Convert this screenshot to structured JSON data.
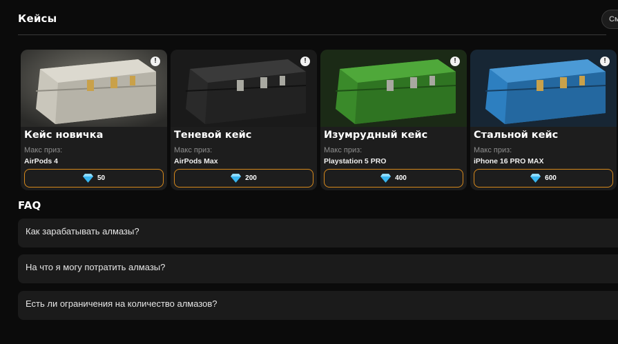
{
  "cases_section": {
    "title": "Кейсы",
    "see_all_label": "См"
  },
  "faq_section": {
    "title": "FAQ"
  },
  "cases": [
    {
      "name": "Кейс новичка",
      "prize_label": "Макс приз:",
      "prize": "AirPods 4",
      "price": "50",
      "color": "#c9c6bb"
    },
    {
      "name": "Теневой кейс",
      "prize_label": "Макс приз:",
      "prize": "AirPods Max",
      "price": "200",
      "color": "#2a2a2a"
    },
    {
      "name": "Изумрудный кейс",
      "prize_label": "Макс приз:",
      "prize": "Playstation 5 PRO",
      "price": "400",
      "color": "#3a8a2a"
    },
    {
      "name": "Стальной кейс",
      "prize_label": "Макс приз:",
      "prize": "iPhone 16 PRO MAX",
      "price": "600",
      "color": "#2d7fc0"
    }
  ],
  "faq": [
    {
      "question": "Как зарабатывать алмазы?"
    },
    {
      "question": "На что я могу потратить алмазы?"
    },
    {
      "question": "Есть ли ограничения на количество алмазов?"
    }
  ],
  "colors": {
    "accent_border": "#d98a1c",
    "gem": "#38b6f0",
    "card_bg": "#1d1d1d",
    "page_bg": "#0b0b0b"
  },
  "icons": {
    "info": "info-icon",
    "gem": "diamond-icon"
  }
}
